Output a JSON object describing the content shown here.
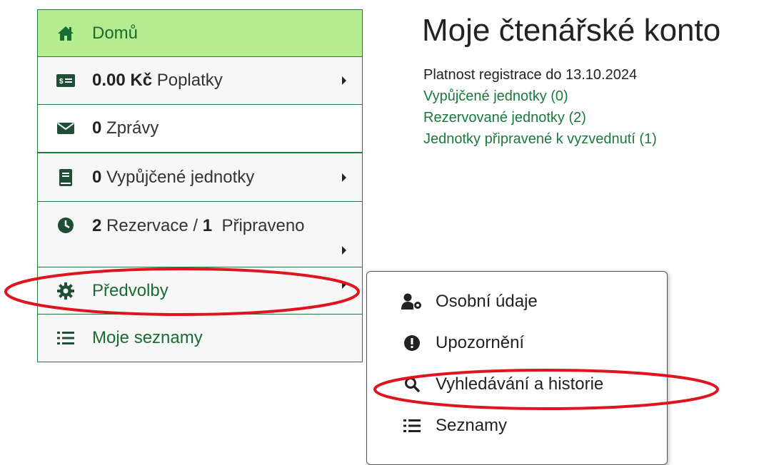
{
  "sidebar": {
    "home": {
      "label": "Domů",
      "icon": "home-icon"
    },
    "fees": {
      "amount": "0.00 Kč",
      "label": " Poplatky",
      "icon": "money-icon"
    },
    "messages": {
      "count": "0",
      "label": " Zprávy",
      "icon": "envelope-icon"
    },
    "checkouts": {
      "count": "0",
      "label": " Vypůjčené jednotky",
      "icon": "book-icon"
    },
    "holds": {
      "count": "2",
      "label": " Rezervace / ",
      "ready_count": "1",
      "ready_label": "  Připraveno",
      "icon": "clock-icon"
    },
    "preferences": {
      "label": "Předvolby",
      "icon": "gear-icon"
    },
    "lists": {
      "label": "Moje seznamy",
      "icon": "list-icon"
    }
  },
  "main": {
    "title": "Moje čtenářské konto",
    "expiration": "Platnost registrace do 13.10.2024",
    "links": {
      "checked_out": "Vypůjčené jednotky (0)",
      "holds": "Rezervované jednotky (2)",
      "ready": "Jednotky připravené k vyzvednutí (1)"
    }
  },
  "dropdown": {
    "personal": {
      "label": "Osobní údaje",
      "icon": "user-cog-icon"
    },
    "notifications": {
      "label": "Upozornění",
      "icon": "exclamation-icon"
    },
    "search_history": {
      "label": "Vyhledávání a historie",
      "icon": "search-icon"
    },
    "lists": {
      "label": "Seznamy",
      "icon": "list-icon"
    }
  },
  "colors": {
    "accent": "#1a6b33",
    "active_bg": "#b5ec8f",
    "annotation": "#e0141e"
  }
}
